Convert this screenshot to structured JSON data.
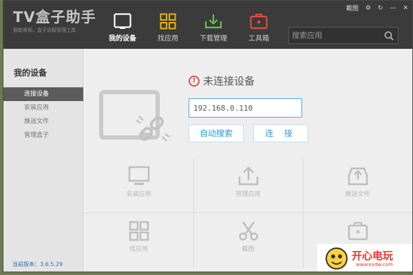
{
  "app": {
    "title": "TV盒子助手",
    "subtitle": "智能电视，盒子远程管理工具"
  },
  "nav": [
    {
      "label": "我的设备",
      "icon": "tv-icon",
      "active": true,
      "color": "#ffffff"
    },
    {
      "label": "找应用",
      "icon": "grid-apps-icon",
      "active": false,
      "color": "#f0b400"
    },
    {
      "label": "下载管理",
      "icon": "download-icon",
      "active": false,
      "color": "#6cc24a"
    },
    {
      "label": "工具箱",
      "icon": "toolbox-icon",
      "active": false,
      "color": "#e64b3c"
    }
  ],
  "search": {
    "placeholder": "搜索应用"
  },
  "window_controls": {
    "screenshot": "截图"
  },
  "sidebar": {
    "title": "我的设备",
    "items": [
      {
        "label": "连接设备",
        "active": true
      },
      {
        "label": "安装应用",
        "active": false
      },
      {
        "label": "推送文件",
        "active": false
      },
      {
        "label": "管理盒子",
        "active": false
      }
    ],
    "version": "当前版本：3.6.5.29"
  },
  "main": {
    "status": "未连接设备",
    "ip_value": "192.168.0.110",
    "scan_button": "自动搜索",
    "connect_button": "连 接",
    "tiles": [
      {
        "label": "安装应用",
        "icon": "monitor-icon"
      },
      {
        "label": "管理应用",
        "icon": "upload-icon"
      },
      {
        "label": "推送文件",
        "icon": "inbox-upload-icon"
      },
      {
        "label": "找应用",
        "icon": "grid-apps-icon"
      },
      {
        "label": "截图",
        "icon": "scissors-icon"
      },
      {
        "label": "",
        "icon": "briefcase-icon"
      }
    ]
  },
  "watermark": {
    "brand": "开心电玩",
    "url": "www.kxdw.com"
  },
  "colors": {
    "header_bg": "#3b3b3b",
    "accent_blue": "#2d9ad8",
    "sidebar_active": "#5c5c5c",
    "warning_red": "#d9534f"
  }
}
